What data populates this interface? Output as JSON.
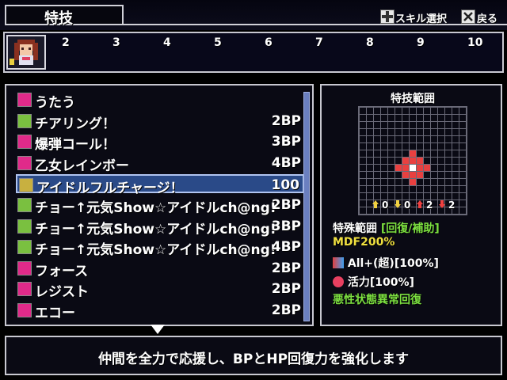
{
  "header": {
    "title": "特技",
    "hint_skill_select": "スキル選択",
    "hint_back": "戻る"
  },
  "party": {
    "slot_numbers": [
      "2",
      "3",
      "4",
      "5",
      "6",
      "7",
      "8",
      "9",
      "10"
    ]
  },
  "skills": [
    {
      "name": "うたう",
      "cost": "",
      "icon_color": "#e02a8a"
    },
    {
      "name": "チアリング！",
      "cost": "2BP",
      "icon_color": "#7ac040"
    },
    {
      "name": "爆弾コール！",
      "cost": "3BP",
      "icon_color": "#e02a8a"
    },
    {
      "name": "乙女レインボー",
      "cost": "4BP",
      "icon_color": "#e02a8a"
    },
    {
      "name": "アイドルフルチャージ！",
      "cost": "100",
      "icon_color": "#c8b040",
      "selected": true
    },
    {
      "name": "チョー↑元気Show☆アイドルch@ng!",
      "cost": "2BP",
      "icon_color": "#7ac040"
    },
    {
      "name": "チョー↑元気Show☆アイドルch@ng!",
      "cost": "3BP",
      "icon_color": "#7ac040"
    },
    {
      "name": "チョー↑元気Show☆アイドルch@ng!",
      "cost": "4BP",
      "icon_color": "#7ac040"
    },
    {
      "name": "フォース",
      "cost": "2BP",
      "icon_color": "#e02a8a"
    },
    {
      "name": "レジスト",
      "cost": "2BP",
      "icon_color": "#e02a8a"
    },
    {
      "name": "エコー",
      "cost": "2BP",
      "icon_color": "#e02a8a"
    }
  ],
  "info": {
    "range_title": "特技範囲",
    "range_counts": [
      "0",
      "0",
      "2",
      "2"
    ],
    "special_range_label": "特殊範囲",
    "special_range_value": "[回復/補助]",
    "line_mdf": "MDF200%",
    "line_all": "All+(超)[100%]",
    "line_vitality": "活力[100%]",
    "line_cure": "悪性状態異常回復",
    "accent_yellow": "#f0e040",
    "accent_green": "#7ce040"
  },
  "description": "仲間を全力で応援し、BPとHP回復力を強化します"
}
